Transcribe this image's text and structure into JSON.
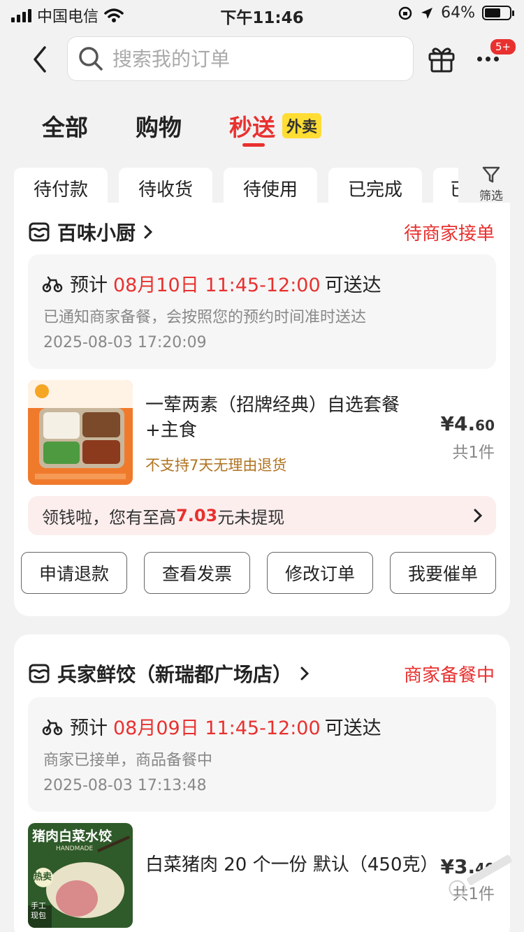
{
  "status_bar": {
    "carrier": "中国电信",
    "time": "下午11:46",
    "battery_percent": "64%",
    "battery_level": 0.64
  },
  "search": {
    "placeholder": "搜索我的订单"
  },
  "header": {
    "more_badge": "5+"
  },
  "tabs": [
    {
      "label": "全部"
    },
    {
      "label": "购物"
    },
    {
      "label": "秒送",
      "tag": "外卖",
      "active": true
    }
  ],
  "filters": {
    "chips": [
      "待付款",
      "待收货",
      "待使用",
      "已完成",
      "已"
    ],
    "filter_label": "筛选"
  },
  "orders": [
    {
      "shop": "百味小厨",
      "status": "待商家接单",
      "eta_prefix": "预计",
      "eta_time": "08月10日 11:45-12:00",
      "eta_suffix": "可送达",
      "note": "已通知商家备餐，会按照您的预约时间准时送达",
      "timestamp": "2025-08-03 17:20:09",
      "item_name": "一荤两素（招牌经典）自选套餐+主食",
      "item_note": "不支持7天无理由退货",
      "price_int": "¥4.",
      "price_dec": "60",
      "count": "共1件",
      "cashback_prefix": "领钱啦，您有至高",
      "cashback_amount": "7.03",
      "cashback_suffix": "元未提现",
      "buttons": [
        "申请退款",
        "查看发票",
        "修改订单",
        "我要催单"
      ]
    },
    {
      "shop": "兵家鲜饺（新瑞都广场店）",
      "status": "商家备餐中",
      "eta_prefix": "预计",
      "eta_time": "08月09日 11:45-12:00",
      "eta_suffix": "可送达",
      "note": "商家已接单，商品备餐中",
      "timestamp": "2025-08-03 17:13:48",
      "item_name": "白菜猪肉 20 个一份 默认（450克）",
      "thumb_title": "猪肉白菜水饺",
      "thumb_sub": "HANDMADE",
      "thumb_badge": "热卖",
      "thumb_corner": "手工现包",
      "price_int": "¥3.",
      "price_dec": "40",
      "count": "共1件"
    }
  ],
  "colors": {
    "accent": "#e8312f",
    "tag_yellow": "#ffdd33",
    "note_brown": "#b07320"
  }
}
